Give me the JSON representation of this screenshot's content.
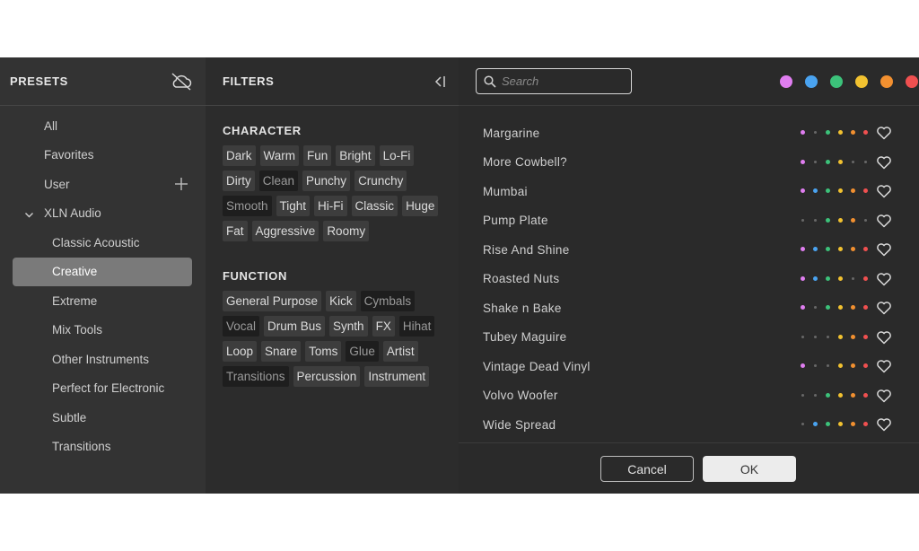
{
  "presets": {
    "title": "PRESETS",
    "items": [
      {
        "label": "All",
        "level": 1
      },
      {
        "label": "Favorites",
        "level": 1
      },
      {
        "label": "User",
        "level": 1
      },
      {
        "label": "XLN Audio",
        "level": 1
      },
      {
        "label": "Classic Acoustic",
        "level": 2
      },
      {
        "label": "Creative",
        "level": 2,
        "selected": true
      },
      {
        "label": "Extreme",
        "level": 2
      },
      {
        "label": "Mix Tools",
        "level": 2
      },
      {
        "label": "Other Instruments",
        "level": 2
      },
      {
        "label": "Perfect for Electronic",
        "level": 2
      },
      {
        "label": "Subtle",
        "level": 2
      },
      {
        "label": "Transitions",
        "level": 2
      }
    ]
  },
  "filters": {
    "title": "FILTERS",
    "character": {
      "title": "CHARACTER",
      "tags": [
        {
          "label": "Dark",
          "active": true
        },
        {
          "label": "Warm",
          "active": true
        },
        {
          "label": "Fun",
          "active": true
        },
        {
          "label": "Bright",
          "active": true
        },
        {
          "label": "Lo-Fi",
          "active": true
        },
        {
          "label": "Dirty",
          "active": true
        },
        {
          "label": "Clean",
          "active": false
        },
        {
          "label": "Punchy",
          "active": true
        },
        {
          "label": "Crunchy",
          "active": true
        },
        {
          "label": "Smooth",
          "active": false
        },
        {
          "label": "Tight",
          "active": true
        },
        {
          "label": "Hi-Fi",
          "active": true
        },
        {
          "label": "Classic",
          "active": true
        },
        {
          "label": "Huge",
          "active": true
        },
        {
          "label": "Fat",
          "active": true
        },
        {
          "label": "Aggressive",
          "active": true
        },
        {
          "label": "Roomy",
          "active": true
        }
      ]
    },
    "function": {
      "title": "FUNCTION",
      "tags": [
        {
          "label": "General Purpose",
          "active": true
        },
        {
          "label": "Kick",
          "active": true
        },
        {
          "label": "Cymbals",
          "active": false
        },
        {
          "label": "Vocal",
          "active": false
        },
        {
          "label": "Drum Bus",
          "active": true
        },
        {
          "label": "Synth",
          "active": true
        },
        {
          "label": "FX",
          "active": true
        },
        {
          "label": "Hihat",
          "active": false
        },
        {
          "label": "Loop",
          "active": true
        },
        {
          "label": "Snare",
          "active": true
        },
        {
          "label": "Toms",
          "active": true
        },
        {
          "label": "Glue",
          "active": false
        },
        {
          "label": "Artist",
          "active": true
        },
        {
          "label": "Transitions",
          "active": false
        },
        {
          "label": "Percussion",
          "active": true
        },
        {
          "label": "Instrument",
          "active": true
        }
      ]
    }
  },
  "search": {
    "placeholder": "Search",
    "value": ""
  },
  "color_filters": [
    "#e07ef0",
    "#4aa3f0",
    "#3cc27a",
    "#f2c230",
    "#f29030",
    "#f05050"
  ],
  "results": [
    {
      "name": "Margarine",
      "tags": [
        1,
        0,
        1,
        1,
        1,
        1
      ]
    },
    {
      "name": "More Cowbell?",
      "tags": [
        1,
        0,
        1,
        1,
        0,
        0
      ]
    },
    {
      "name": "Mumbai",
      "tags": [
        1,
        1,
        1,
        1,
        1,
        1
      ]
    },
    {
      "name": "Pump Plate",
      "tags": [
        0,
        0,
        1,
        1,
        1,
        0
      ]
    },
    {
      "name": "Rise And Shine",
      "tags": [
        1,
        1,
        1,
        1,
        1,
        1
      ]
    },
    {
      "name": "Roasted Nuts",
      "tags": [
        1,
        1,
        1,
        1,
        0,
        1
      ]
    },
    {
      "name": "Shake n Bake",
      "tags": [
        1,
        0,
        1,
        1,
        1,
        1
      ]
    },
    {
      "name": "Tubey Maguire",
      "tags": [
        0,
        0,
        0,
        1,
        1,
        1
      ]
    },
    {
      "name": "Vintage Dead Vinyl",
      "tags": [
        1,
        0,
        0,
        1,
        1,
        1
      ]
    },
    {
      "name": "Volvo Woofer",
      "tags": [
        0,
        0,
        1,
        1,
        1,
        1
      ]
    },
    {
      "name": "Wide Spread",
      "tags": [
        0,
        1,
        1,
        1,
        1,
        1
      ]
    }
  ],
  "footer": {
    "cancel_label": "Cancel",
    "ok_label": "OK"
  }
}
